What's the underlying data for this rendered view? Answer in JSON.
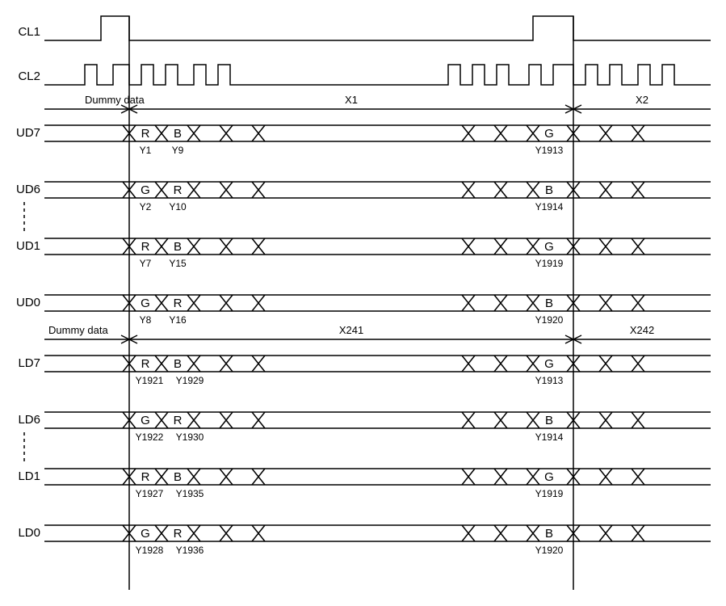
{
  "signals": {
    "cl1": "CL1",
    "cl2": "CL2",
    "ud7": "UD7",
    "ud6": "UD6",
    "ud1": "UD1",
    "ud0": "UD0",
    "ld7": "LD7",
    "ld6": "LD6",
    "ld1": "LD1",
    "ld0": "LD0"
  },
  "spans": {
    "dummy1": "Dummy data",
    "dummy2": "Dummy data",
    "x1": "X1",
    "x2": "X2",
    "x241": "X241",
    "x242": "X242"
  },
  "ud7": {
    "c1": "R",
    "l1": "Y1",
    "c2": "B",
    "l2": "Y9",
    "c3": "G",
    "l3": "Y1913"
  },
  "ud6": {
    "c1": "G",
    "l1": "Y2",
    "c2": "R",
    "l2": "Y10",
    "c3": "B",
    "l3": "Y1914"
  },
  "ud1": {
    "c1": "R",
    "l1": "Y7",
    "c2": "B",
    "l2": "Y15",
    "c3": "G",
    "l3": "Y1919"
  },
  "ud0": {
    "c1": "G",
    "l1": "Y8",
    "c2": "R",
    "l2": "Y16",
    "c3": "B",
    "l3": "Y1920"
  },
  "ld7": {
    "c1": "R",
    "l1": "Y1921",
    "c2": "B",
    "l2": "Y1929",
    "c3": "G",
    "l3": "Y1913"
  },
  "ld6": {
    "c1": "G",
    "l1": "Y1922",
    "c2": "R",
    "l2": "Y1930",
    "c3": "B",
    "l3": "Y1914"
  },
  "ld1": {
    "c1": "R",
    "l1": "Y1927",
    "c2": "B",
    "l2": "Y1935",
    "c3": "G",
    "l3": "Y1919"
  },
  "ld0": {
    "c1": "G",
    "l1": "Y1928",
    "c2": "R",
    "l2": "Y1936",
    "c3": "B",
    "l3": "Y1920"
  }
}
